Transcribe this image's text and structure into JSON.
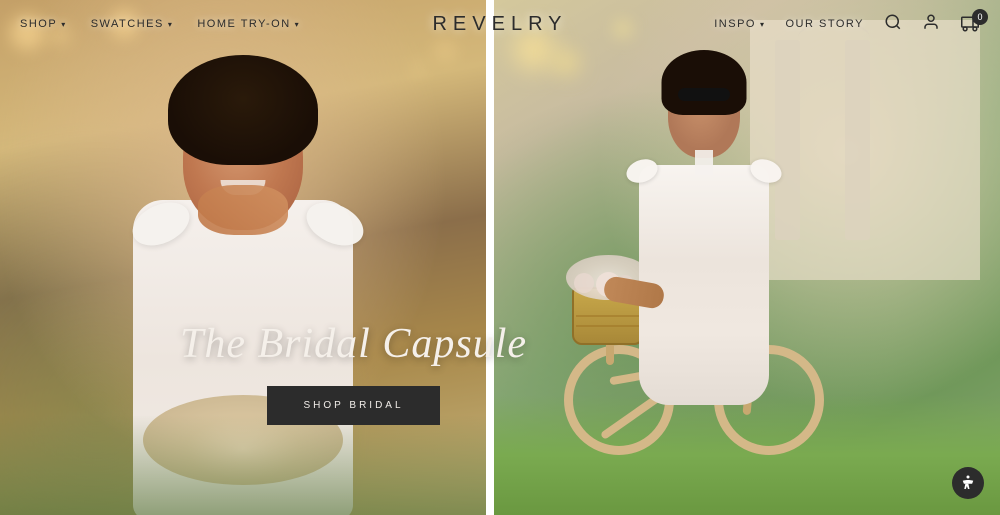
{
  "header": {
    "logo": "REVELRY",
    "nav_left": [
      {
        "label": "SHOP",
        "has_dropdown": true
      },
      {
        "label": "SWATCHES",
        "has_dropdown": true
      },
      {
        "label": "HOME TRY-ON",
        "has_dropdown": true
      }
    ],
    "nav_right": [
      {
        "label": "INSPO",
        "has_dropdown": true
      },
      {
        "label": "OUR STORY",
        "has_dropdown": false
      }
    ],
    "cart_count": "0"
  },
  "hero": {
    "title": "The Bridal Capsule",
    "shop_button_label": "SHOP BRIDAL",
    "left_image_alt": "Woman smiling in white bow dress outdoors",
    "right_image_alt": "Woman in white dress with bicycle and flowers"
  },
  "accessibility": {
    "button_label": "Accessibility"
  }
}
